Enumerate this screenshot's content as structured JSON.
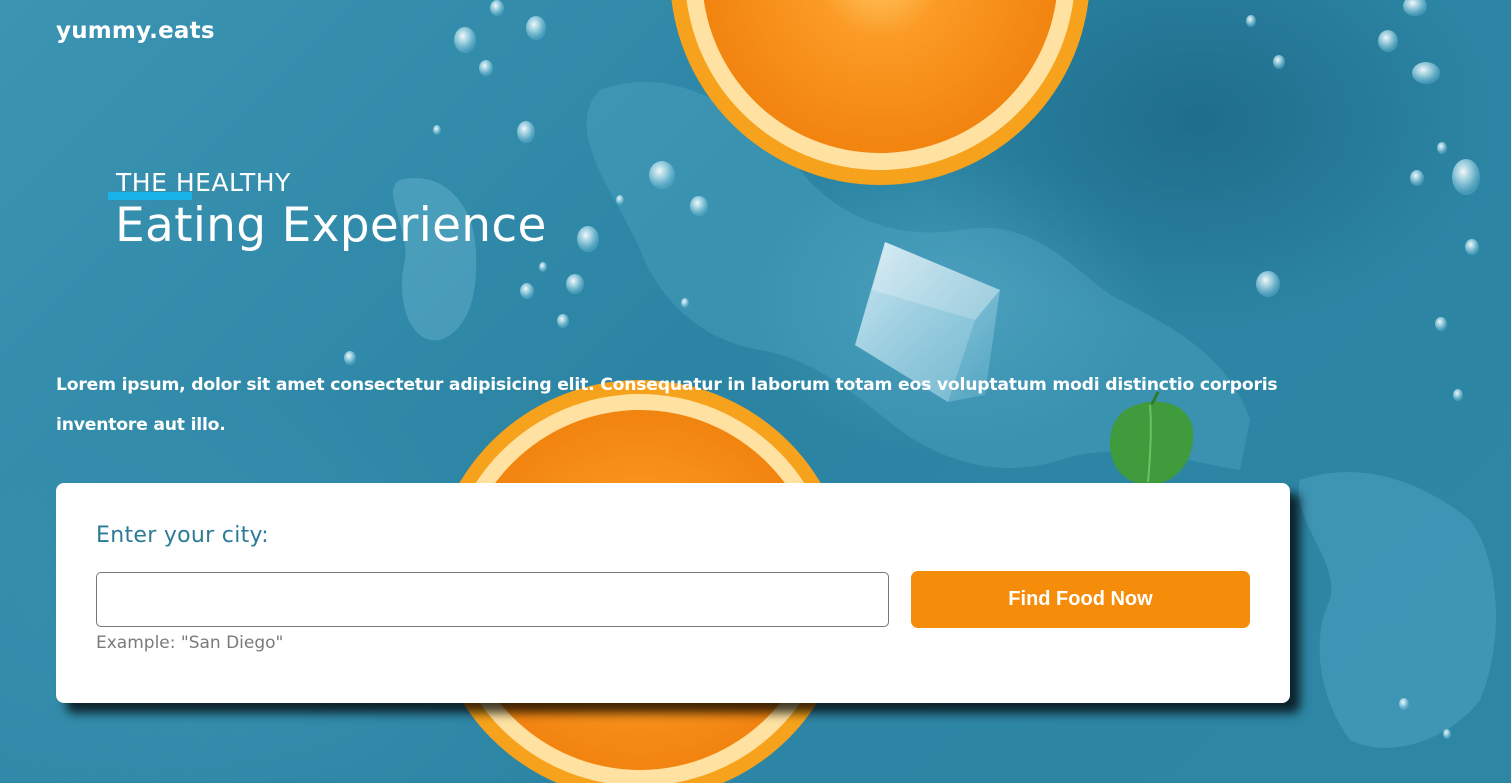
{
  "brand": {
    "name": "yummy.eats"
  },
  "hero": {
    "eyebrow": "THE HEALTHY",
    "title": "Eating Experience",
    "description": "Lorem ipsum, dolor sit amet consectetur adipisicing elit. Consequatur in laborum totam eos voluptatum modi distinctio corporis inventore aut illo."
  },
  "search": {
    "label": "Enter your city:",
    "input_value": "",
    "placeholder": "",
    "hint": "Example: \"San Diego\"",
    "button_label": "Find Food Now"
  },
  "colors": {
    "background": "#2f88a6",
    "accent_underline": "#19b3ea",
    "button": "#f58d0a",
    "label_text": "#2c7b97",
    "orange_peel": "#f7a21c",
    "orange_flesh": "#f98c1a"
  },
  "background_image": {
    "subject": "orange-slices-ice-cube-water-drops-mint-leaf"
  }
}
